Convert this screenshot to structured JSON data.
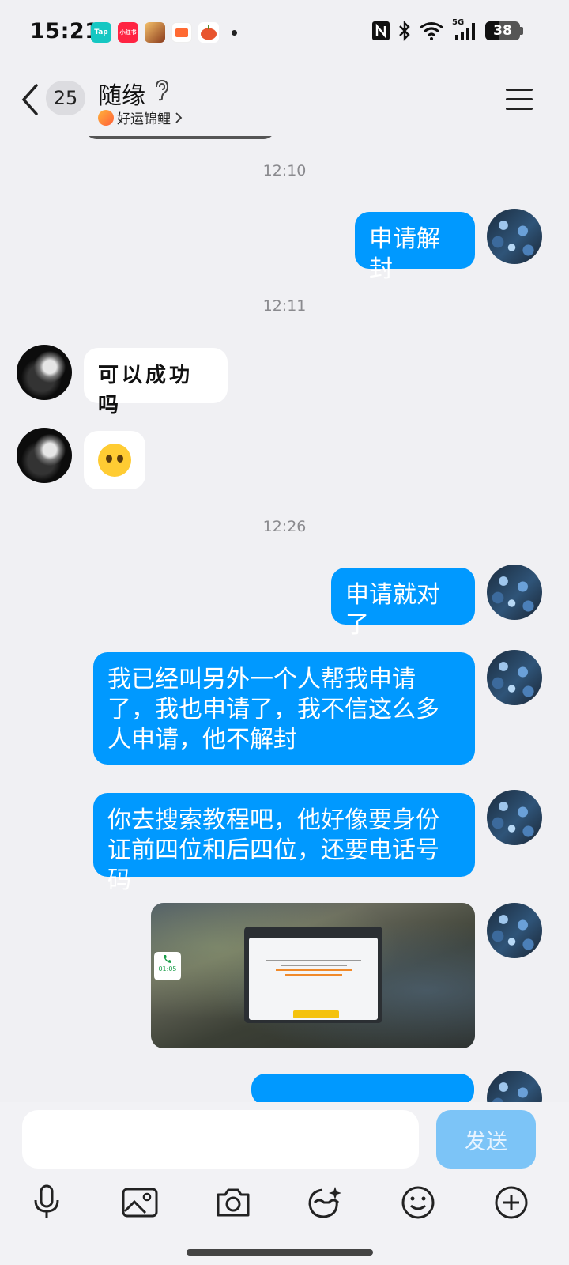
{
  "status_bar": {
    "time": "15:21",
    "apps": [
      {
        "name": "taptap-icon",
        "label": "Tap",
        "color": "#15c7c2"
      },
      {
        "name": "xiaohongshu-icon",
        "label": "小红书",
        "color": "#ff2442"
      },
      {
        "name": "game-icon",
        "label": "",
        "color": "#b8653a"
      },
      {
        "name": "video-icon",
        "label": "",
        "color": "#ff6a33"
      },
      {
        "name": "pumpkin-icon",
        "label": "",
        "color": "#e8542e"
      }
    ],
    "network": "5G",
    "battery_level": "38",
    "battery_fraction": 0.38
  },
  "header": {
    "unread_count": "25",
    "contact_name": "随缘",
    "contact_status": "好运锦鲤"
  },
  "chat": {
    "timestamps": [
      "12:10",
      "12:11",
      "12:26"
    ],
    "messages": {
      "m1": "申请解封",
      "m2": "可以成功吗",
      "m4": "申请就对了",
      "m5": "我已经叫另外一个人帮我申请了，我也申请了，我不信这么多人申请，他不解封",
      "m6": "你去搜索教程吧，他好像要身份证前四位和后四位，还要电话号码"
    },
    "screenshot": {
      "call_time": "01:05"
    }
  },
  "input": {
    "send_label": "发送"
  },
  "colors": {
    "my_bubble": "#0099ff",
    "their_bubble": "#ffffff",
    "background": "#f0f0f3",
    "send_disabled": "#7cc4f7"
  }
}
